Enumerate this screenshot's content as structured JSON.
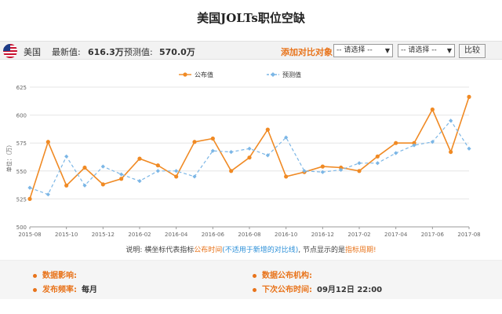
{
  "title": "美国JOLTs职位空缺",
  "infobar": {
    "country": "美国",
    "latest_label": "最新值:",
    "latest_value": "616.3万",
    "forecast_label": "预测值:",
    "forecast_value": "570.0万",
    "compare_label": "添加对比对象:",
    "select1": "-- 请选择 --",
    "select2": "-- 请选择 --",
    "compare_button": "比较"
  },
  "note": {
    "p1": "说明: 横坐标代表指标",
    "p2": "公布时间",
    "p3": "(不适用于新增的对比线)",
    "p4": ", 节点显示的是",
    "p5": "指标周期!"
  },
  "footer": {
    "impact_label": "数据影响:",
    "impact_value": "",
    "frequency_label": "发布频率:",
    "frequency_value": "每月",
    "agency_label": "数据公布机构:",
    "agency_value": "",
    "next_label": "下次公布时间:",
    "next_value": "09月12日 22:00"
  },
  "chart_data": {
    "type": "line",
    "title": "",
    "xlabel": "",
    "ylabel": "单位：（万）",
    "legend_position": "top-center",
    "ylim": [
      500,
      625
    ],
    "yticks": [
      500,
      525,
      550,
      575,
      600,
      625
    ],
    "x_tick_labels": [
      "2015-08",
      "2015-10",
      "2015-12",
      "2016-02",
      "2016-04",
      "2016-06",
      "2016-08",
      "2016-10",
      "2016-12",
      "2017-02",
      "2017-04",
      "2017-06",
      "2017-08"
    ],
    "x_tick_indices": [
      0,
      2,
      4,
      6,
      8,
      10,
      12,
      14,
      16,
      18,
      20,
      22,
      24
    ],
    "grid": "horizontal",
    "series": [
      {
        "name": "公布值",
        "color": "#f08a24",
        "style": "solid",
        "points": [
          [
            0,
            525
          ],
          [
            1,
            576
          ],
          [
            2,
            537
          ],
          [
            3,
            553
          ],
          [
            4,
            538
          ],
          [
            5,
            543
          ],
          [
            6,
            561
          ],
          [
            7,
            555
          ],
          [
            8,
            545
          ],
          [
            9,
            576
          ],
          [
            10,
            579
          ],
          [
            11,
            550
          ],
          [
            12,
            562
          ],
          [
            13,
            587
          ],
          [
            14,
            545
          ],
          [
            15,
            549
          ],
          [
            16,
            554
          ],
          [
            17,
            553
          ],
          [
            18,
            550
          ],
          [
            19,
            563
          ],
          [
            20,
            575
          ],
          [
            21,
            575
          ],
          [
            22,
            605
          ],
          [
            23,
            567
          ],
          [
            24,
            616.3
          ]
        ]
      },
      {
        "name": "预测值",
        "color": "#7bb6e6",
        "style": "dashed",
        "points": [
          [
            0,
            535
          ],
          [
            1,
            529
          ],
          [
            2,
            563
          ],
          [
            3,
            537
          ],
          [
            4,
            554
          ],
          [
            5,
            547
          ],
          [
            6,
            541
          ],
          [
            7,
            550
          ],
          [
            8,
            550
          ],
          [
            9,
            545
          ],
          [
            10,
            568
          ],
          [
            11,
            567
          ],
          [
            12,
            570
          ],
          [
            13,
            564
          ],
          [
            14,
            580
          ],
          [
            15,
            550
          ],
          [
            16,
            549
          ],
          [
            17,
            551
          ],
          [
            18,
            557
          ],
          [
            19,
            557
          ],
          [
            20,
            566
          ],
          [
            21,
            573
          ],
          [
            22,
            576
          ],
          [
            23,
            595
          ],
          [
            24,
            570
          ]
        ]
      }
    ]
  }
}
